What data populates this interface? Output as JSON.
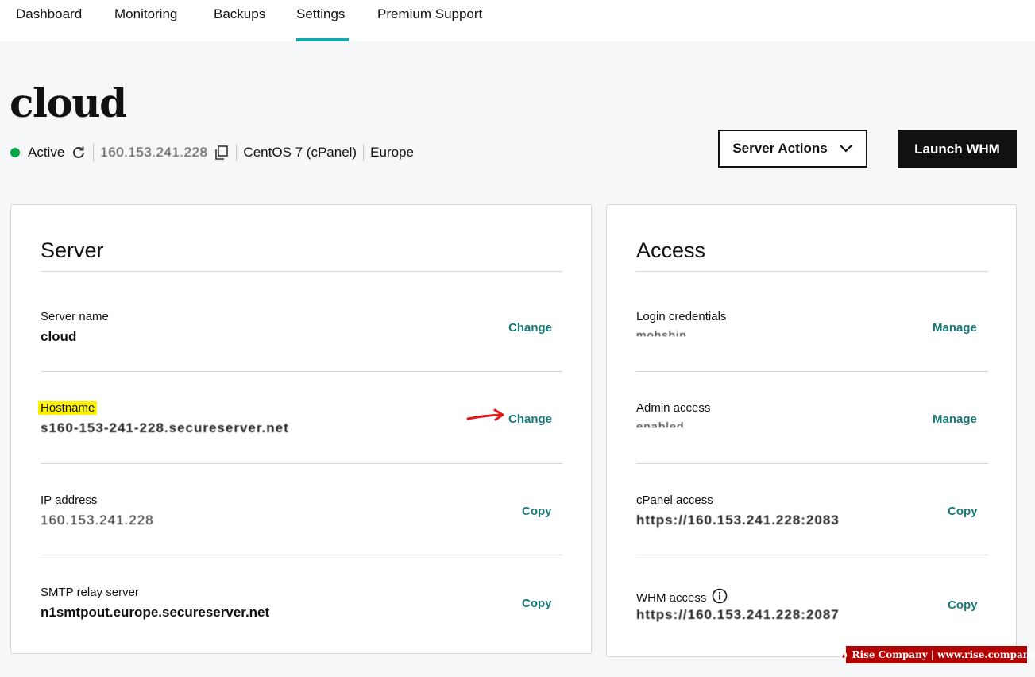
{
  "nav": {
    "items": [
      {
        "label": "Dashboard"
      },
      {
        "label": "Monitoring"
      },
      {
        "label": "Backups"
      },
      {
        "label": "Settings"
      },
      {
        "label": "Premium Support"
      }
    ],
    "active": "Settings"
  },
  "header": {
    "title": "cloud",
    "status": "Active",
    "ip": "160.153.241.228",
    "os": "CentOS 7 (cPanel)",
    "region": "Europe",
    "server_actions_label": "Server Actions",
    "launch_label": "Launch WHM"
  },
  "server_card": {
    "title": "Server",
    "rows": [
      {
        "label": "Server name",
        "value": "cloud",
        "action": "Change"
      },
      {
        "label": "Hostname",
        "value": "s160-153-241-228.secureserver.net",
        "action": "Change"
      },
      {
        "label": "IP address",
        "value": "160.153.241.228",
        "action": "Copy"
      },
      {
        "label": "SMTP relay server",
        "value": "n1smtpout.europe.secureserver.net",
        "action": "Copy"
      }
    ]
  },
  "access_card": {
    "title": "Access",
    "rows": [
      {
        "label": "Login credentials",
        "value": "mohsbin",
        "action": "Manage"
      },
      {
        "label": "Admin access",
        "value": "enabled",
        "action": "Manage"
      },
      {
        "label": "cPanel access",
        "value": "https://160.153.241.228:2083",
        "action": "Copy"
      },
      {
        "label": "WHM access",
        "value": "https://160.153.241.228:2087",
        "action": "Copy"
      }
    ]
  },
  "watermark": {
    "brand": "Rise Company",
    "url": "www.rise.company"
  },
  "colors": {
    "accent": "#14a9a9",
    "action_link": "#1a7a7a",
    "status_active": "#00a63f",
    "highlight": "#fff200",
    "arrow": "#e01b1b"
  },
  "icons": [
    "refresh-icon",
    "copy-icon",
    "chevron-down-icon",
    "info-icon",
    "red-arrow-annotation",
    "flame-logo-icon"
  ]
}
